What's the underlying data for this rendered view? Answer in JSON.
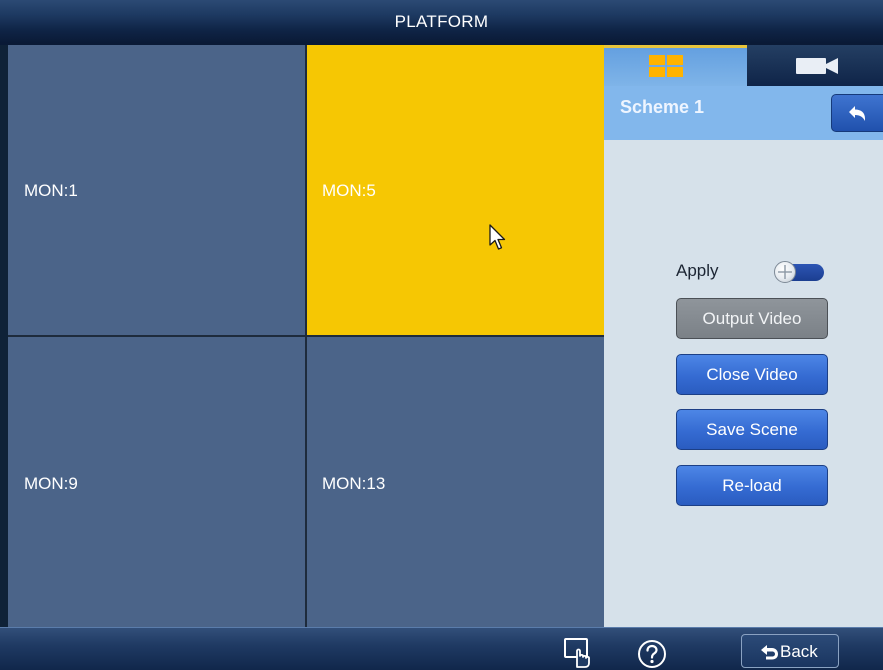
{
  "window": {
    "title": "PLATFORM"
  },
  "monitors": [
    {
      "label": "MON:1",
      "selected": false
    },
    {
      "label": "MON:5",
      "selected": true
    },
    {
      "label": "MON:9",
      "selected": false
    },
    {
      "label": "MON:13",
      "selected": false
    }
  ],
  "colors": {
    "monitor": "#4b6489",
    "monitor_selected": "#f6c703",
    "panel": "#d6e1ea",
    "accent_blue": "#356bd2"
  },
  "panel": {
    "tabs": [
      {
        "icon": "layout-grid-icon",
        "active": true
      },
      {
        "icon": "camera-icon",
        "active": false
      }
    ],
    "scheme_title": "Scheme 1",
    "return_icon": "return-arrow-icon",
    "apply": {
      "label": "Apply",
      "enabled": true
    },
    "buttons": {
      "output_video": "Output Video",
      "close_video": "Close Video",
      "save_scene": "Save Scene",
      "reload": "Re-load"
    }
  },
  "bottom_bar": {
    "touch_icon": "touch-hand-icon",
    "help_icon": "help-icon",
    "back_label": "Back"
  }
}
